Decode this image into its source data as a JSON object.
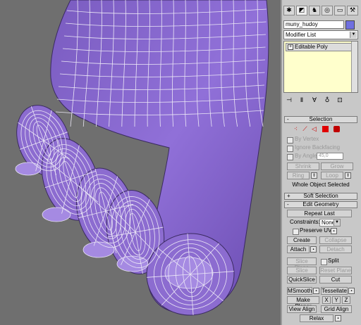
{
  "colors": {
    "mesh": "#8c6cd0",
    "wire": "#e8e4f4",
    "panel": "#c8c8c8",
    "viewport_bg": "#6f6f6f",
    "stack_bg": "#ffffcc",
    "selected_icon": "#e00000"
  },
  "object": {
    "name": "muny_hudoy"
  },
  "modifier_list": {
    "label": "Modifier List"
  },
  "stack": {
    "item": "Editable Poly"
  },
  "tabs": [
    "create-icon",
    "modify-icon",
    "hierarchy-icon",
    "motion-icon",
    "display-icon",
    "utilities-icon"
  ],
  "selection": {
    "title": "Selection",
    "by_vertex": "By Vertex",
    "ignore_backfacing": "Ignore Backfacing",
    "by_angle": "By Angle:",
    "angle_value": "45,0",
    "shrink": "Shrink",
    "grow": "Grow",
    "ring": "Ring",
    "loop": "Loop",
    "status": "Whole Object Selected"
  },
  "soft_selection": {
    "title": "Soft Selection"
  },
  "edit_geometry": {
    "title": "Edit Geometry",
    "repeat_last": "Repeat Last",
    "constraints_label": "Constraints:",
    "constraints_value": "None",
    "preserve_uvs": "Preserve UVs",
    "create": "Create",
    "collapse": "Collapse",
    "attach": "Attach",
    "detach": "Detach",
    "slice_plane": "Slice Plane",
    "split": "Split",
    "slice": "Slice",
    "reset_plane": "Reset Plane",
    "quickslice": "QuickSlice",
    "cut": "Cut",
    "msmooth": "MSmooth",
    "tessellate": "Tessellate",
    "make_planar": "Make Planar",
    "x": "X",
    "y": "Y",
    "z": "Z",
    "view_align": "View Align",
    "grid_align": "Grid Align",
    "relax": "Relax"
  }
}
